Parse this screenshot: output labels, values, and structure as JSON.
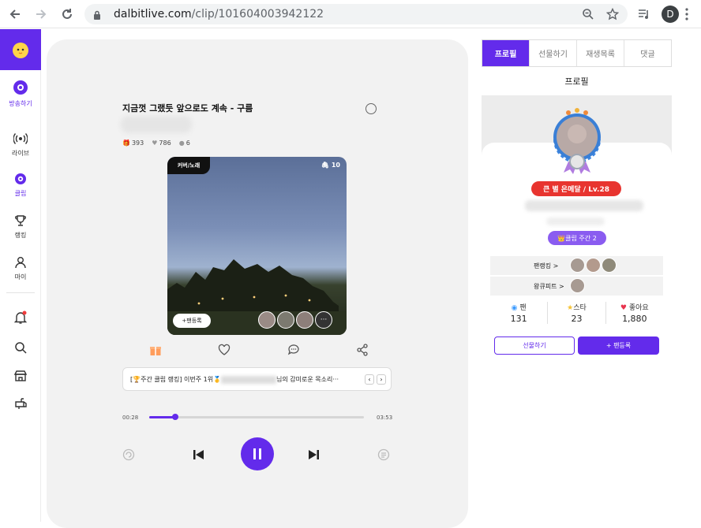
{
  "browser": {
    "url_host": "dalbitlive.com",
    "url_path": "/clip/101604003942122",
    "profile_initial": "D"
  },
  "sidebar": {
    "items": [
      {
        "label": "방송하기",
        "icon": "broadcast-icon"
      },
      {
        "label": "라이브",
        "icon": "live-icon"
      },
      {
        "label": "클립",
        "icon": "clip-icon"
      },
      {
        "label": "랭킹",
        "icon": "trophy-icon"
      },
      {
        "label": "마이",
        "icon": "person-icon"
      }
    ]
  },
  "clip": {
    "title": "지금껏 그랬듯 앞으로도 계속 - 구름",
    "gifts": "393",
    "likes": "786",
    "comments": "6",
    "category": "커버/노래",
    "clip_count": "10",
    "fan_add": "+팬등록",
    "more": "···",
    "ticker_pre": "[🏆주간 클립 랭킹] 이번주 1위🥇",
    "ticker_post": "님의 감미로운 목소리···",
    "ticker_prev": "‹",
    "ticker_next": "›",
    "time_current": "00:28",
    "time_total": "03:53",
    "progress": 0.12
  },
  "right_panel": {
    "tabs": [
      "프로필",
      "선물하기",
      "재생목록",
      "댓글"
    ],
    "active_tab": 0,
    "header": "프로필",
    "level_badge": "큰 별 은메달 / Lv.28",
    "weekly_badge": "👑클립 주간 2",
    "fan_rank_label": "팬랭킹",
    "wang_cupid_label": "왕큐피트",
    "stats": [
      {
        "label": "팬",
        "value": "131"
      },
      {
        "label": "스타",
        "value": "23"
      },
      {
        "label": "좋아요",
        "value": "1,880"
      }
    ],
    "gift_button": "선물하기",
    "fan_button": "+ 팬등록"
  },
  "colors": {
    "brand": "#632beb",
    "red_badge": "#e8342f"
  }
}
